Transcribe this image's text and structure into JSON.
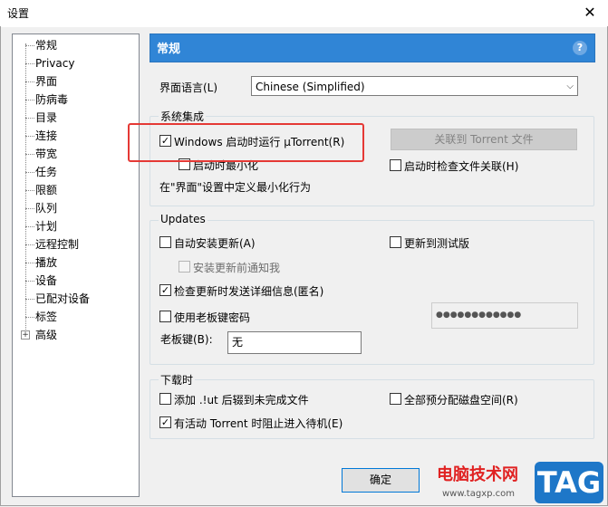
{
  "window": {
    "title": "设置",
    "close_glyph": "✕"
  },
  "tree": {
    "items": [
      {
        "label": "常规"
      },
      {
        "label": "Privacy"
      },
      {
        "label": "界面"
      },
      {
        "label": "防病毒"
      },
      {
        "label": "目录"
      },
      {
        "label": "连接"
      },
      {
        "label": "带宽"
      },
      {
        "label": "任务"
      },
      {
        "label": "限额"
      },
      {
        "label": "队列"
      },
      {
        "label": "计划"
      },
      {
        "label": "远程控制"
      },
      {
        "label": "播放"
      },
      {
        "label": "设备"
      },
      {
        "label": "已配对设备"
      },
      {
        "label": "标签"
      },
      {
        "label": "高级"
      }
    ],
    "expander_glyph": "+"
  },
  "header": {
    "title": "常规",
    "help_glyph": "?"
  },
  "language": {
    "label": "界面语言(L)",
    "value": "Chinese (Simplified)",
    "arrow": "⌵"
  },
  "system": {
    "title": "系统集成",
    "run_on_startup": {
      "label": "Windows 启动时运行 µTorrent(R)",
      "checked": true
    },
    "start_minimized": {
      "label": "启动时最小化",
      "checked": false
    },
    "associate_button": "关联到 Torrent 文件",
    "check_assoc": {
      "label": "启动时检查文件关联(H)",
      "checked": false
    },
    "note": "在\"界面\"设置中定义最小化行为"
  },
  "updates": {
    "title": "Updates",
    "auto_install": {
      "label": "自动安装更新(A)",
      "checked": false
    },
    "beta": {
      "label": "更新到测试版",
      "checked": false
    },
    "notify_before": {
      "label": "安装更新前通知我",
      "checked": false
    },
    "anon_info": {
      "label": "检查更新时发送详细信息(匿名)",
      "checked": true
    },
    "boss_key_pw": {
      "label": "使用老板键密码",
      "checked": false
    },
    "password_mask": "●●●●●●●●●●●●",
    "boss_key_label": "老板键(B):",
    "boss_key_value": "无"
  },
  "downloads": {
    "title": "下载时",
    "append_ut": {
      "label": "添加 .!ut 后辍到未完成文件",
      "checked": false
    },
    "prealloc": {
      "label": "全部预分配磁盘空间(R)",
      "checked": false
    },
    "prevent_standby": {
      "label": "有活动 Torrent 时阻止进入待机(E)",
      "checked": true
    }
  },
  "footer": {
    "ok_label": "确定"
  },
  "watermark": {
    "site": "电脑技术网",
    "url": "www.tagxp.com",
    "tag": "TAG"
  },
  "colors": {
    "header_blue": "#3085d6",
    "highlight_red": "#e53935"
  }
}
